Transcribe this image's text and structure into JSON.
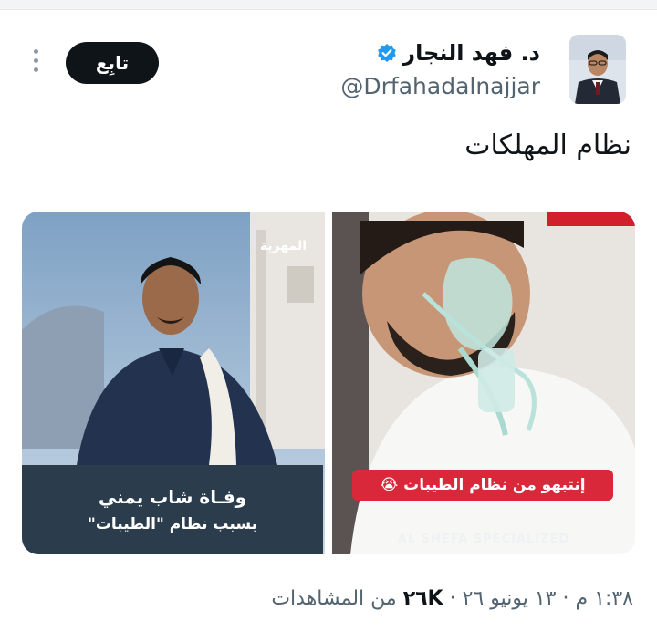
{
  "tweet": {
    "author_name": "د. فهد النجار",
    "handle": "@Drfahadalnajjar",
    "follow_label": "تابِع",
    "text": "نظام المهلكات",
    "media": {
      "left_caption_line1": "وفـاة شاب يمني",
      "left_caption_line2": "بسبب نظام \"الطيبات\"",
      "left_brand": "المهرية",
      "right_caption": "إنتبهو من نظام الطيبات 😭",
      "right_watermark": "AL SHEFA SPECIALIZED"
    },
    "meta": {
      "time": "١:٣٨ م",
      "date": "١٣ يونيو ٢٦",
      "separator": "·",
      "views_count": "٢٦K",
      "views_label": "من المشاهدات"
    }
  },
  "colors": {
    "verified_blue": "#1d9bf0",
    "follow_bg": "#0f1419",
    "secondary_text": "#536471",
    "caption_red": "#d8283a"
  },
  "icons": {
    "verified": "verified-badge-icon",
    "more": "vertical-ellipsis-icon"
  }
}
